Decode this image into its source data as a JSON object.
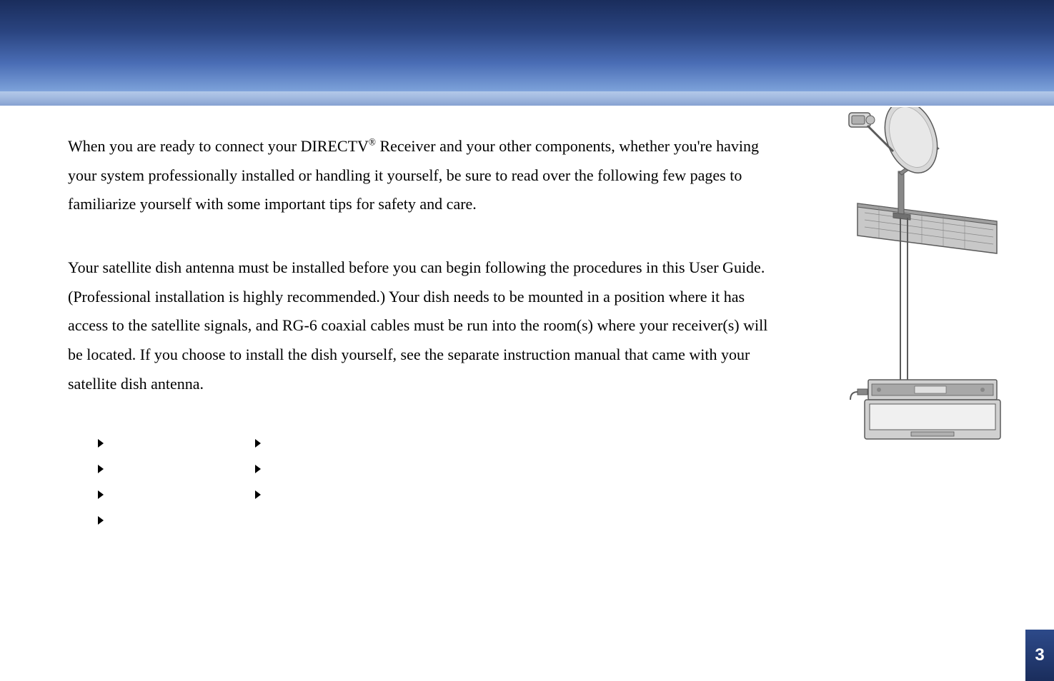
{
  "paragraphs": {
    "para1_before": "When you are ready to connect your DIRECTV",
    "para1_sup": "®",
    "para1_after": " Receiver and your other components, whether you're having your system professionally installed or handling it yourself, be sure to read over the following few pages to familiarize yourself with some important tips for safety and care.",
    "para2": "Your satellite dish antenna must be installed before you can begin following the procedures in this User Guide. (Professional installation is highly recommended.) Your dish needs to be mounted in a position where it has access to the satellite signals, and RG-6 coaxial cables must be run into the room(s) where your receiver(s) will be located. If you choose to install the dish yourself, see the separate instruction manual that came with your satellite dish antenna."
  },
  "bullets": {
    "col1": [
      "",
      "",
      "",
      ""
    ],
    "col2": [
      "",
      "",
      ""
    ]
  },
  "page_number": "3",
  "illustration": {
    "alt": "satellite-dish-and-receiver-diagram",
    "colors": {
      "stroke": "#5a5a5a",
      "fill_light": "#d8d8d8",
      "fill_mid": "#b0b0b0",
      "fill_dark": "#888888",
      "screen": "#e8e8e8"
    }
  }
}
